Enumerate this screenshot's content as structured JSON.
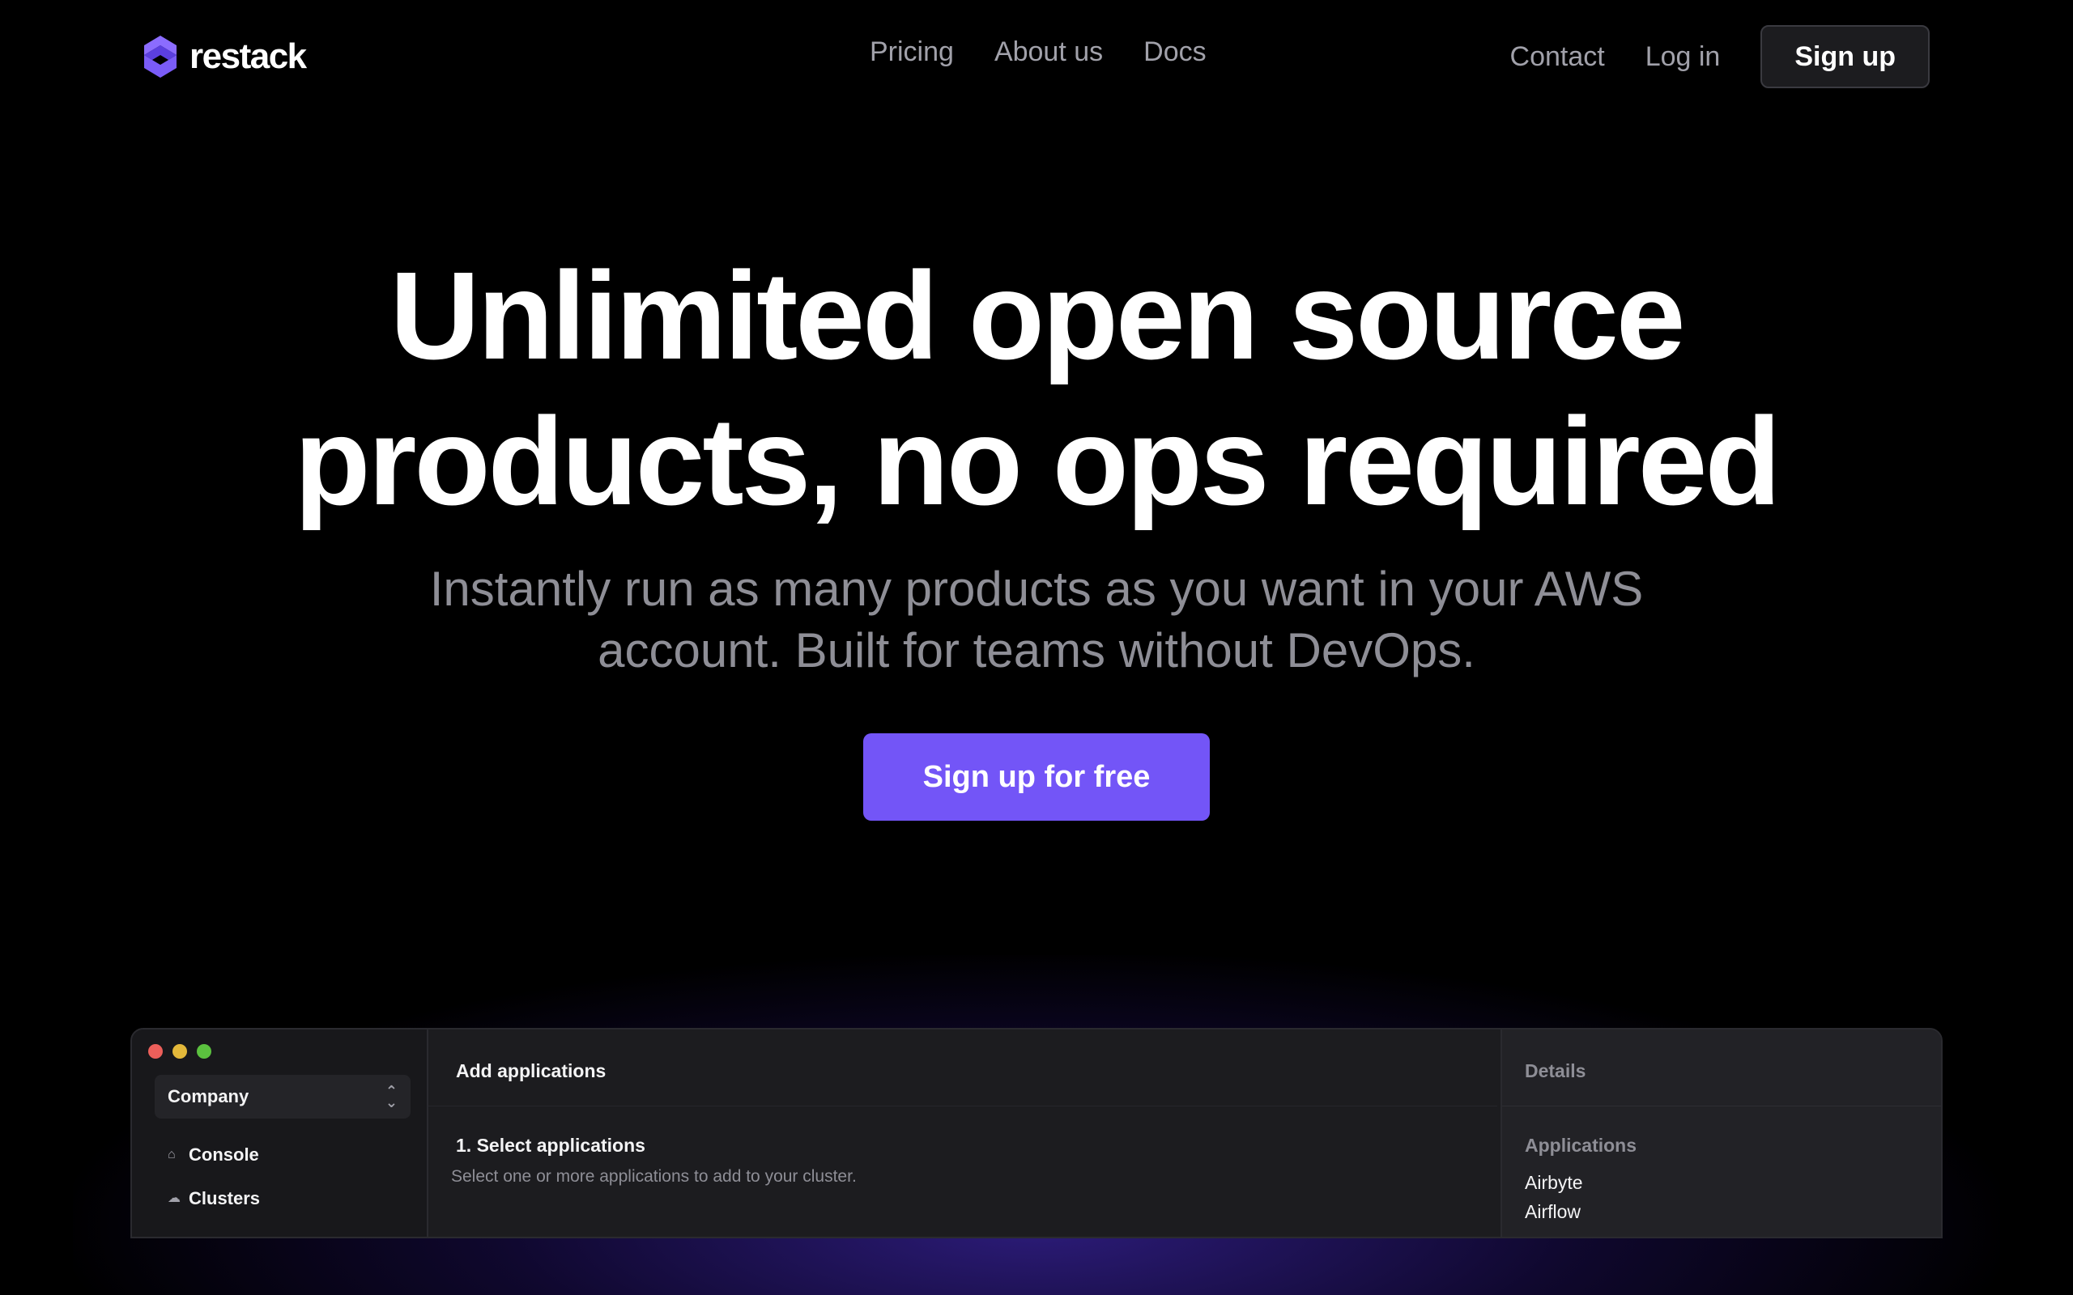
{
  "brand": {
    "name": "restack",
    "accent": "#7355f7"
  },
  "nav": {
    "center": [
      "Pricing",
      "About us",
      "Docs"
    ],
    "contact": "Contact",
    "login": "Log in",
    "signup": "Sign up"
  },
  "hero": {
    "title_line1": "Unlimited open source",
    "title_line2": "products, no ops required",
    "subtitle_line1": "Instantly run as many products as you want in your AWS",
    "subtitle_line2": "account. Built for teams without DevOps.",
    "cta": "Sign up for free"
  },
  "app": {
    "org_selector": "Company",
    "sidebar": [
      {
        "label": "Console",
        "icon": "home-icon"
      },
      {
        "label": "Clusters",
        "icon": "cloud-icon"
      }
    ],
    "main": {
      "title": "Add applications",
      "step_title": "1. Select applications",
      "step_desc": "Select one or more applications to add to your cluster."
    },
    "details": {
      "title": "Details",
      "apps_label": "Applications",
      "apps": [
        "Airbyte",
        "Airflow"
      ]
    }
  }
}
